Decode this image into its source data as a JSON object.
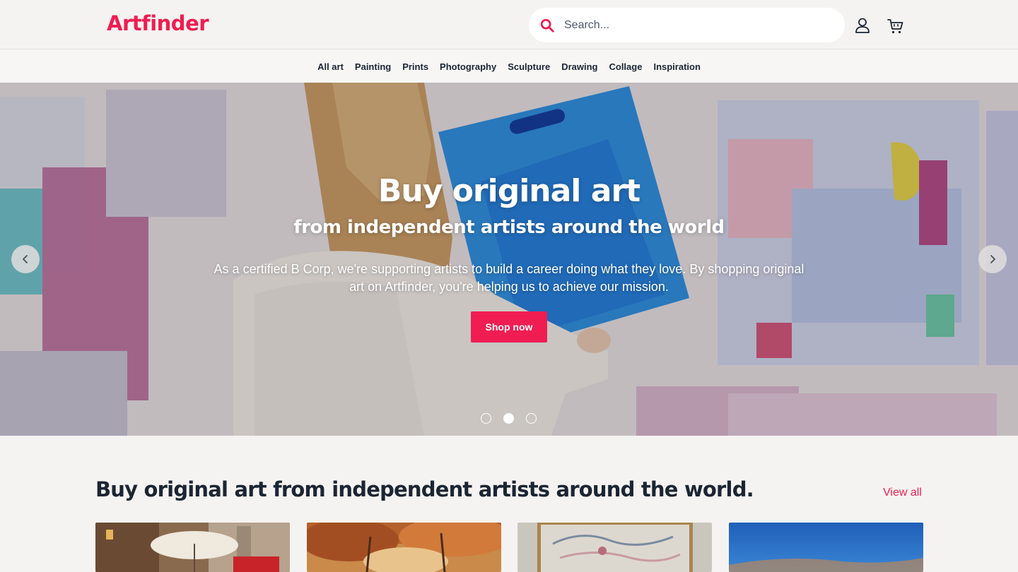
{
  "header": {
    "logo": "Artfinder",
    "search_placeholder": "Search...",
    "icons": [
      "search-icon",
      "user-icon",
      "cart-icon"
    ]
  },
  "nav": {
    "items": [
      {
        "label": "All art"
      },
      {
        "label": "Painting"
      },
      {
        "label": "Prints"
      },
      {
        "label": "Photography"
      },
      {
        "label": "Sculpture"
      },
      {
        "label": "Drawing"
      },
      {
        "label": "Collage"
      },
      {
        "label": "Inspiration"
      }
    ]
  },
  "hero": {
    "title": "Buy original art",
    "subtitle": "from independent artists around the world",
    "body": "As a certified B Corp, we're supporting artists to build a career doing what they love. By shopping original art on Artfinder, you're helping us to achieve our mission.",
    "cta_label": "Shop now",
    "carousel_slides": 3,
    "active_slide": 2
  },
  "section": {
    "title": "Buy original art from independent artists around the world.",
    "view_all": "View all"
  },
  "colors": {
    "brand": "#ef1d52",
    "text": "#1b2533",
    "background": "#f5f3f1"
  }
}
